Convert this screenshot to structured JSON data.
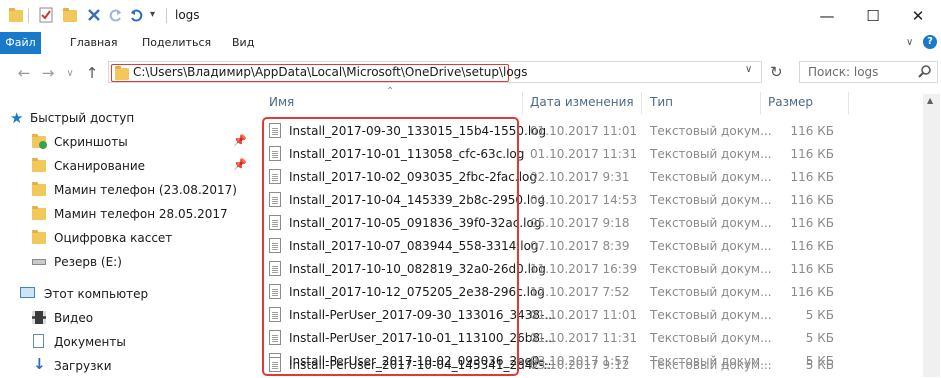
{
  "window": {
    "title": "logs"
  },
  "ribbon": {
    "tabs": [
      "Файл",
      "Главная",
      "Поделиться",
      "Вид"
    ]
  },
  "address": {
    "path": "C:\\Users\\Владимир\\AppData\\Local\\Microsoft\\OneDrive\\setup\\logs"
  },
  "search": {
    "placeholder": "Поиск: logs"
  },
  "nav": {
    "quick_access": "Быстрый доступ",
    "items": [
      {
        "label": "Скриншоты",
        "pinned": true
      },
      {
        "label": "Сканирование",
        "pinned": true
      },
      {
        "label": "Мамин телефон (23.08.2017)",
        "pinned": false
      },
      {
        "label": "Мамин телефон 28.05.2017",
        "pinned": false
      },
      {
        "label": "Оцифровка кассет",
        "pinned": false
      },
      {
        "label": "Резерв (E:)",
        "pinned": false
      }
    ],
    "this_pc": "Этот компьютер",
    "pc_items": [
      "Видео",
      "Документы",
      "Загрузки"
    ]
  },
  "columns": {
    "name": "Имя",
    "date": "Дата изменения",
    "type": "Тип",
    "size": "Размер"
  },
  "files": [
    {
      "name": "Install_2017-09-30_133015_15b4-1550.log",
      "date": "01.10.2017 11:01",
      "type": "Текстовый докум...",
      "size": "116 КБ"
    },
    {
      "name": "Install_2017-10-01_113058_cfc-63c.log",
      "date": "01.10.2017 11:31",
      "type": "Текстовый докум...",
      "size": "116 КБ"
    },
    {
      "name": "Install_2017-10-02_093035_2fbc-2fac.log",
      "date": "02.10.2017 9:31",
      "type": "Текстовый докум...",
      "size": "116 КБ"
    },
    {
      "name": "Install_2017-10-04_145339_2b8c-2950.log",
      "date": "04.10.2017 14:53",
      "type": "Текстовый докум...",
      "size": "116 КБ"
    },
    {
      "name": "Install_2017-10-05_091836_39f0-32ac.log",
      "date": "05.10.2017 9:18",
      "type": "Текстовый докум...",
      "size": "116 КБ"
    },
    {
      "name": "Install_2017-10-07_083944_558-3314.log",
      "date": "07.10.2017 8:39",
      "type": "Текстовый докум...",
      "size": "116 КБ"
    },
    {
      "name": "Install_2017-10-10_082819_32a0-26d0.log",
      "date": "11.10.2017 16:39",
      "type": "Текстовый докум...",
      "size": "116 КБ"
    },
    {
      "name": "Install_2017-10-12_075205_2e38-296c.log",
      "date": "12.10.2017 7:52",
      "type": "Текстовый докум...",
      "size": "116 КБ"
    },
    {
      "name": "Install-PerUser_2017-09-30_133016_3438-...",
      "date": "01.10.2017 11:01",
      "type": "Текстовый докум...",
      "size": "5 КБ"
    },
    {
      "name": "Install-PerUser_2017-10-01_113100_26b8-...",
      "date": "01.10.2017 11:31",
      "type": "Текстовый докум...",
      "size": "5 КБ"
    },
    {
      "name": "Install-PerUser_2017-10-02_093036_2ee0-...",
      "date": "03.10.2017 1:57",
      "type": "Текстовый докум...",
      "size": "5 КБ"
    },
    {
      "name": "Install-PerUser_2017-10-04_145341_2d4c-...",
      "date": "05.10.2017 9:12",
      "type": "Текстовый докум...",
      "size": "5 КБ"
    }
  ],
  "colors": {
    "accent": "#1979ca",
    "highlight": "#e03a35",
    "folder": "#f3c85b"
  }
}
